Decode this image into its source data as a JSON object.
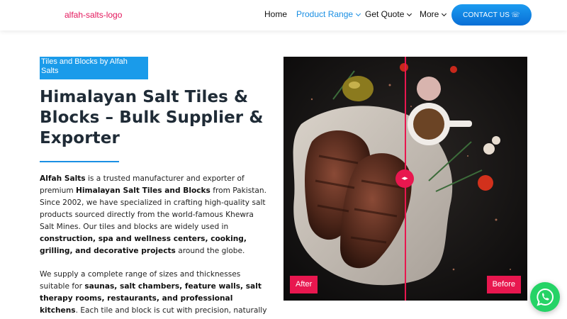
{
  "header": {
    "logo_text": "alfah-salts-logo",
    "nav": [
      {
        "label": "Home",
        "has_chevron": false,
        "active": false
      },
      {
        "label": "Product Range",
        "has_chevron": true,
        "active": true
      },
      {
        "label": "Get Quote",
        "has_chevron": true,
        "active": false
      },
      {
        "label": "More",
        "has_chevron": true,
        "active": false
      }
    ],
    "contact_label": "CONTACT US",
    "contact_icon": "phone-icon"
  },
  "hero": {
    "eyebrow": "Tiles and Blocks by Alfah Salts",
    "title": "Himalayan Salt Tiles & Blocks – Bulk Supplier & Exporter",
    "p1": [
      {
        "t": "Alfah Salts",
        "b": true
      },
      {
        "t": " is a trusted manufacturer and exporter of premium ",
        "b": false
      },
      {
        "t": "Himalayan Salt Tiles and Blocks",
        "b": true
      },
      {
        "t": " from Pakistan. Since 2002, we have specialized in crafting high-quality salt products sourced directly from the world-famous Khewra Salt Mines. Our tiles and blocks are widely used in ",
        "b": false
      },
      {
        "t": "construction, spa and wellness centers, cooking, grilling, and decorative projects",
        "b": true
      },
      {
        "t": " around the globe.",
        "b": false
      }
    ],
    "p2": [
      {
        "t": "We supply a complete range of sizes and thicknesses suitable for ",
        "b": false
      },
      {
        "t": "saunas, salt chambers, feature walls, salt therapy rooms, restaurants, and professional kitchens",
        "b": true
      },
      {
        "t": ". Each tile and block is cut with precision, naturally rich in trace minerals, and features",
        "b": false
      }
    ]
  },
  "comparison": {
    "after_label": "After",
    "before_label": "Before",
    "handle_glyph": "◂▸",
    "accent": "#e8174f"
  },
  "colors": {
    "brand_blue": "#1a8fe3",
    "logo_pink": "#e3165b",
    "whatsapp": "#25d366"
  },
  "floating": {
    "whatsapp_icon": "whatsapp-icon"
  }
}
